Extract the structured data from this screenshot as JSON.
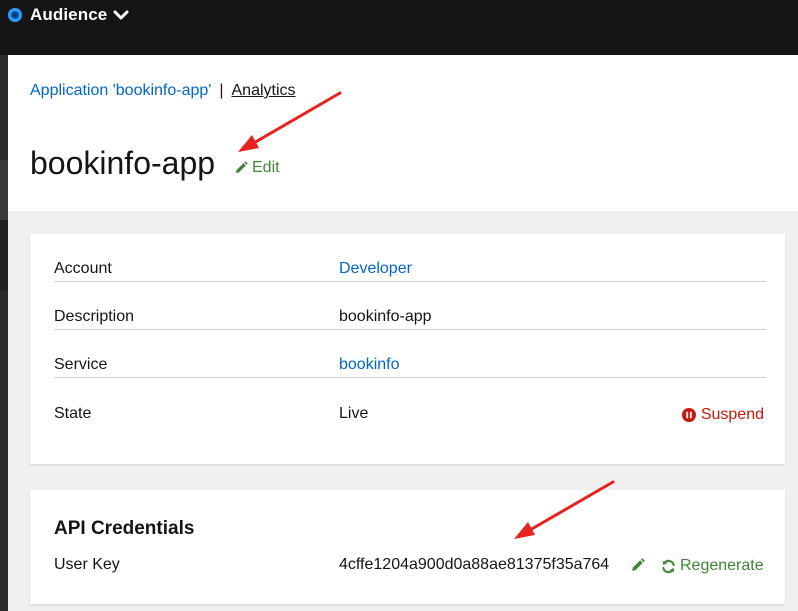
{
  "topbar": {
    "title": "Audience"
  },
  "breadcrumb": {
    "parent": "Application 'bookinfo-app'",
    "separator": "|",
    "current": "Analytics"
  },
  "page": {
    "title": "bookinfo-app",
    "edit_label": "Edit"
  },
  "details": {
    "rows": [
      {
        "label": "Account",
        "value": "Developer",
        "is_link": true
      },
      {
        "label": "Description",
        "value": "bookinfo-app",
        "is_link": false
      },
      {
        "label": "Service",
        "value": "bookinfo",
        "is_link": true
      },
      {
        "label": "State",
        "value": "Live",
        "is_link": false,
        "action": "Suspend"
      }
    ]
  },
  "credentials": {
    "title": "API Credentials",
    "user_key_label": "User Key",
    "user_key": "4cffe1204a900d0a88ae81375f35a764",
    "regenerate_label": "Regenerate"
  },
  "icons": {
    "edit": "pencil-icon",
    "suspend": "pause-circle-icon",
    "regenerate": "sync-icon",
    "menu": "chevron-down-icon",
    "logo": "target-icon"
  },
  "colors": {
    "link": "#0066cc",
    "success": "#3e8635",
    "danger": "#c9190b",
    "annotation": "#e8221c",
    "topbar": "#151515"
  }
}
